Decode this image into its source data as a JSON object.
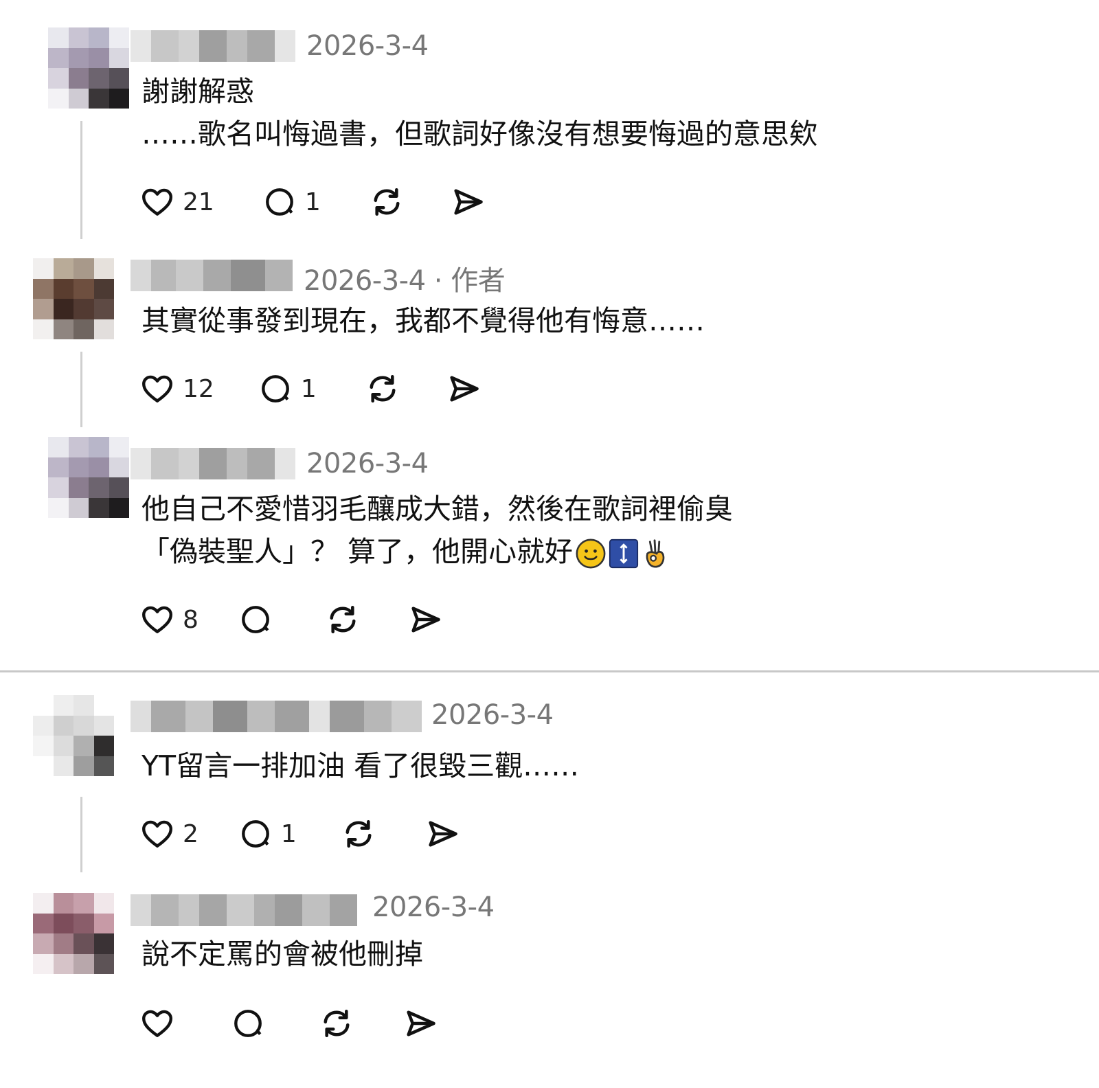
{
  "divider": true,
  "comments": [
    {
      "date": "2026-3-4",
      "lines": [
        "謝謝解惑",
        "……歌名叫悔過書，但歌詞好像沒有想要悔過的意思欸"
      ],
      "likes": "21",
      "replies": "1",
      "icons": [
        "heart-icon",
        "comment-icon",
        "repost-icon",
        "share-icon"
      ]
    },
    {
      "date": "2026-3-4 · 作者",
      "lines": [
        "其實從事發到現在，我都不覺得他有悔意……"
      ],
      "likes": "12",
      "replies": "1"
    },
    {
      "date": "2026-3-4",
      "lines": [
        "他自己不愛惜羽毛釀成大錯，然後在歌詞裡偷臭",
        "「偽裝聖人」？ 算了，他開心就好"
      ],
      "emojis": [
        "smiling-face-emoji",
        "up-down-arrow-emoji",
        "ok-hand-emoji"
      ],
      "likes": "8",
      "replies": ""
    },
    {
      "date": "2026-3-4",
      "lines": [
        "YT留言一排加油 看了很毀三觀……"
      ],
      "likes": "2",
      "replies": "1"
    },
    {
      "date": "2026-3-4",
      "lines": [
        "說不定罵的會被他刪掉"
      ],
      "likes": "",
      "replies": ""
    }
  ]
}
